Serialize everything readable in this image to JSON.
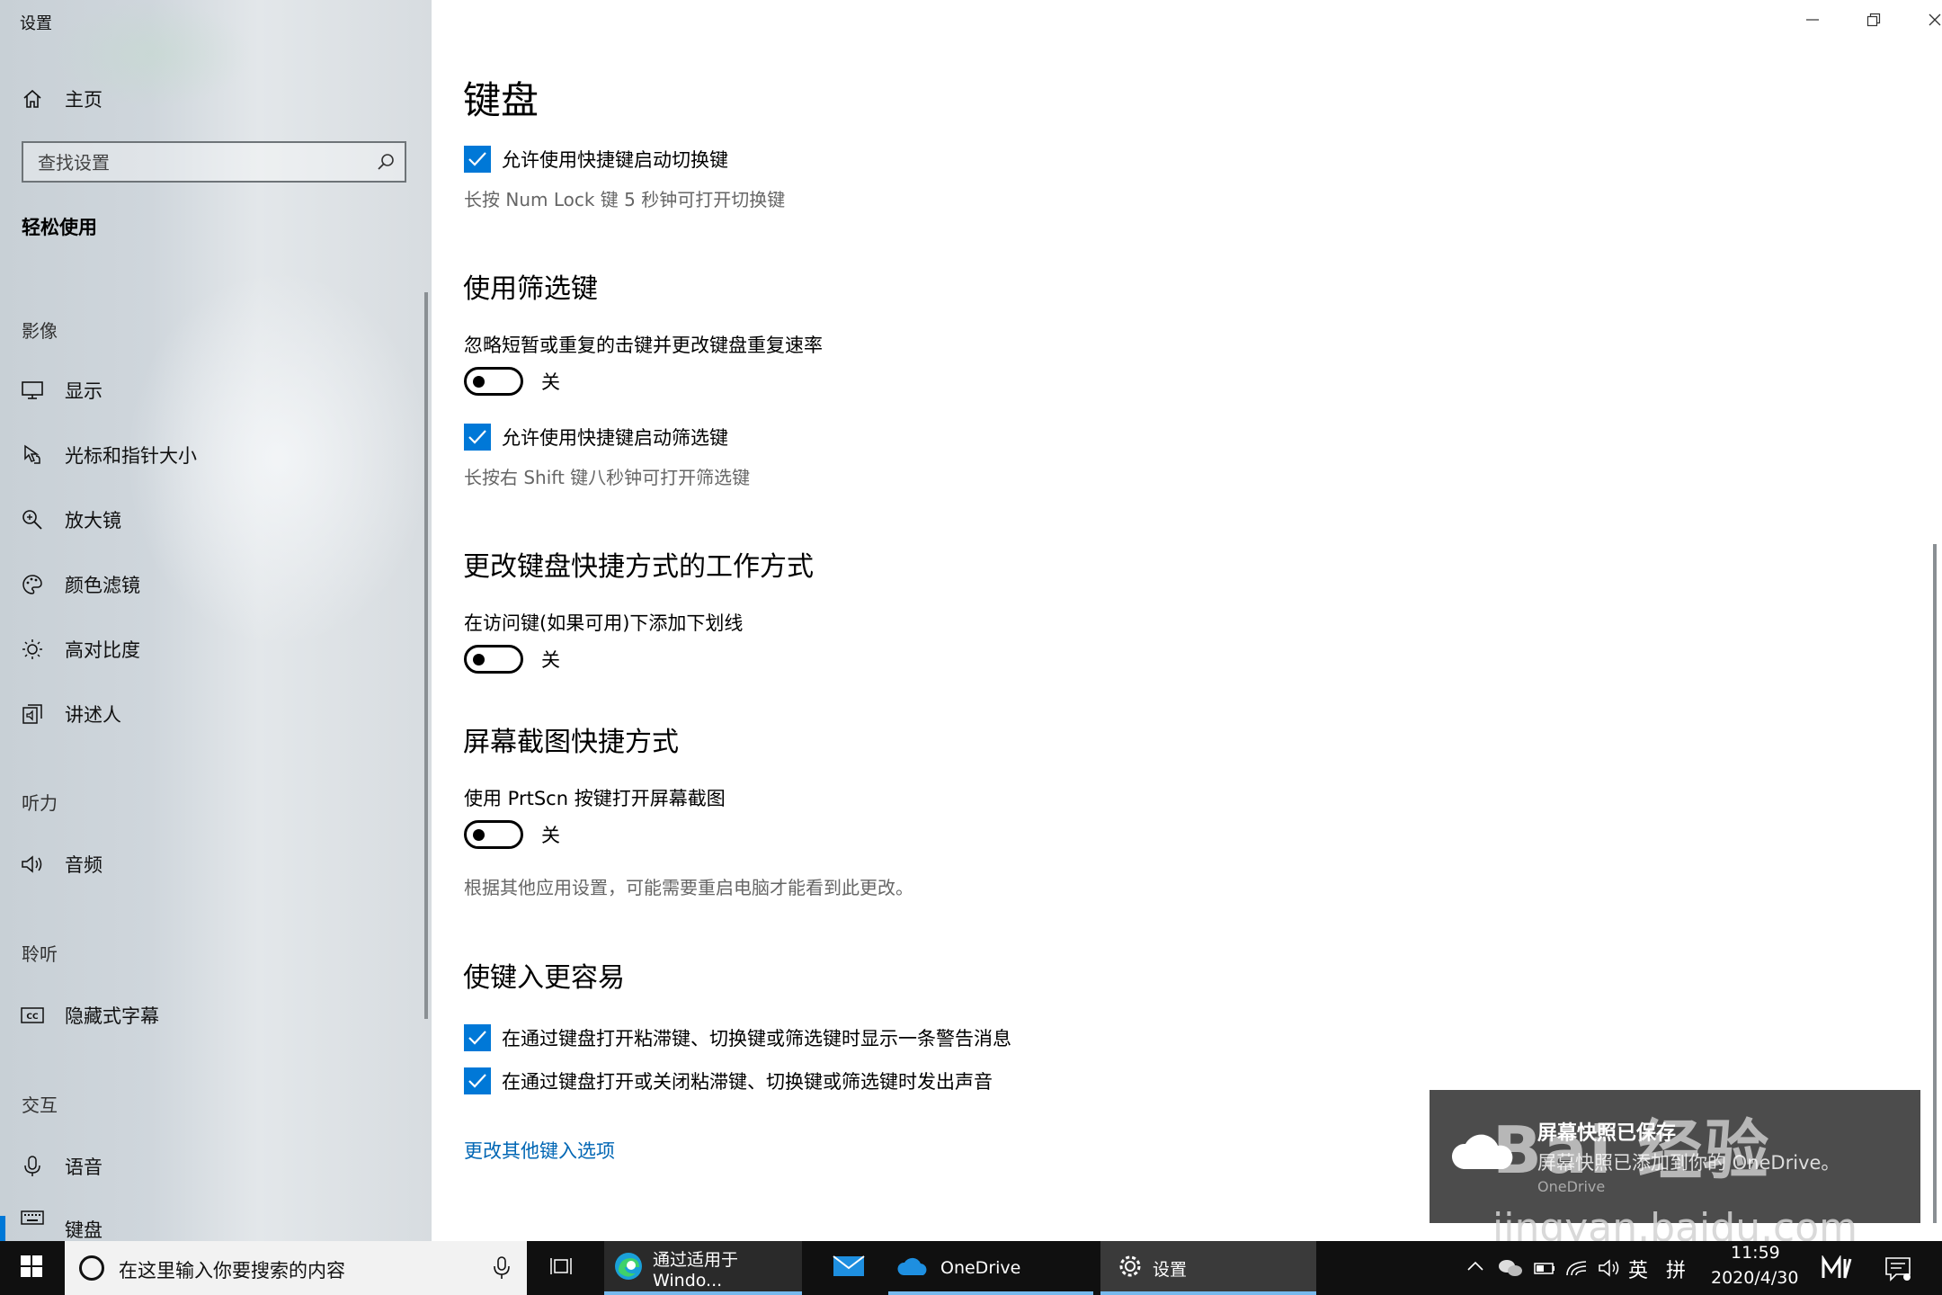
{
  "window": {
    "title": "设置",
    "minimize_icon": "minimize-icon",
    "restore_icon": "restore-icon",
    "close_icon": "close-icon"
  },
  "sidebar": {
    "home_label": "主页",
    "search_placeholder": "查找设置",
    "section": "轻松使用",
    "groups": {
      "vision": "影像",
      "hearing": "听力",
      "hear2": "聆听",
      "interaction": "交互"
    },
    "items": [
      {
        "label": "显示",
        "icon": "monitor-icon"
      },
      {
        "label": "光标和指针大小",
        "icon": "pointer-icon"
      },
      {
        "label": "放大镜",
        "icon": "magnifier-icon"
      },
      {
        "label": "颜色滤镜",
        "icon": "palette-icon"
      },
      {
        "label": "高对比度",
        "icon": "brightness-icon"
      },
      {
        "label": "讲述人",
        "icon": "narrator-icon"
      },
      {
        "label": "音频",
        "icon": "speaker-icon"
      },
      {
        "label": "隐藏式字幕",
        "icon": "cc-icon"
      },
      {
        "label": "语音",
        "icon": "microphone-icon"
      },
      {
        "label": "键盘",
        "icon": "keyboard-icon"
      }
    ]
  },
  "main": {
    "title": "键盘",
    "toggle_keys_checkbox": "允许使用快捷键启动切换键",
    "toggle_keys_hint": "长按 Num Lock 键 5 秒钟可打开切换键",
    "filter_header": "使用筛选键",
    "filter_label": "忽略短暂或重复的击键并更改键盘重复速率",
    "filter_state": "关",
    "filter_checkbox": "允许使用快捷键启动筛选键",
    "filter_hint": "长按右 Shift 键八秒钟可打开筛选键",
    "shortcut_header": "更改键盘快捷方式的工作方式",
    "underline_label": "在访问键(如果可用)下添加下划线",
    "underline_state": "关",
    "prtscn_header": "屏幕截图快捷方式",
    "prtscn_label": "使用 PrtScn 按键打开屏幕截图",
    "prtscn_state": "关",
    "prtscn_hint": "根据其他应用设置，可能需要重启电脑才能看到此更改。",
    "easier_header": "使键入更容易",
    "warn_checkbox": "在通过键盘打开粘滞键、切换键或筛选键时显示一条警告消息",
    "sound_checkbox": "在通过键盘打开或关闭粘滞键、切换键或筛选键时发出声音",
    "more_link": "更改其他键入选项"
  },
  "toast": {
    "title": "屏幕快照已保存",
    "body": "屏幕快照已添加到你的 OneDrive。",
    "source": "OneDrive"
  },
  "watermark": {
    "line1": "Bai 经验",
    "line2": "jingyan.baidu.com"
  },
  "taskbar": {
    "search_text": "在这里输入你要搜索的内容",
    "apps": [
      {
        "label": "通过适用于 Windo...",
        "icon": "edge-icon"
      },
      {
        "label": "",
        "icon": "mail-icon"
      },
      {
        "label": "OneDrive",
        "icon": "onedrive-icon"
      },
      {
        "label": "设置",
        "icon": "gear-icon"
      }
    ],
    "ime_lang": "英",
    "ime_mode": "拼",
    "time": "11:59",
    "date": "2020/4/30"
  }
}
